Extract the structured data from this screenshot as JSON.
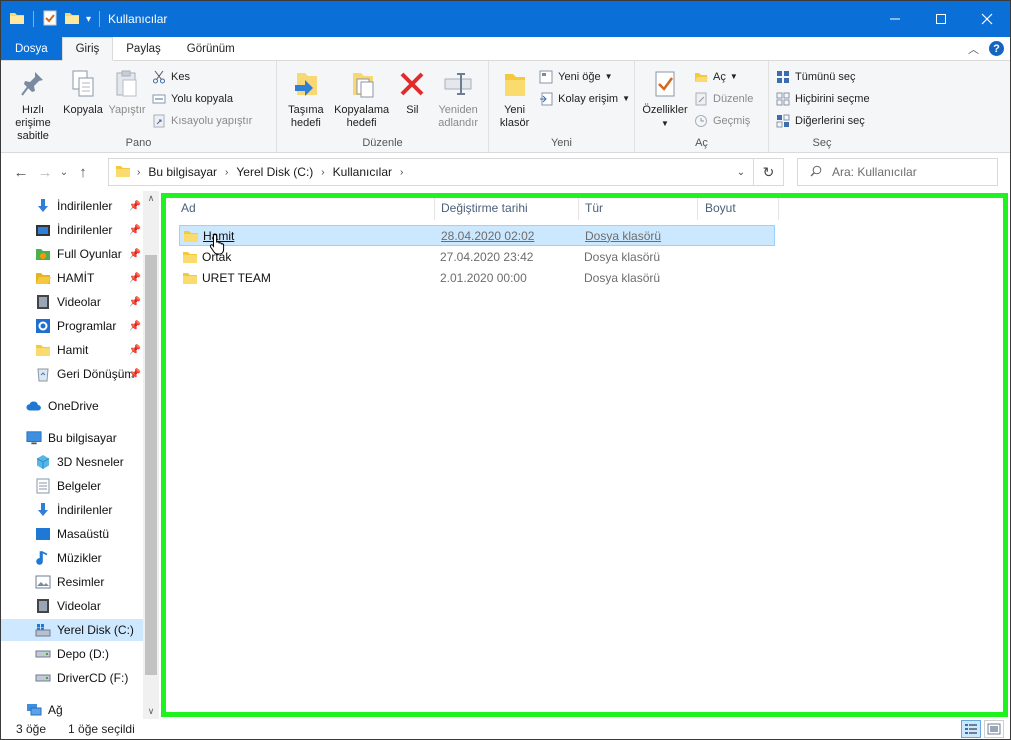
{
  "window": {
    "title": "Kullanıcılar",
    "accent": "#0a6fd6",
    "controls": [
      "minimize",
      "maximize",
      "close"
    ]
  },
  "ribbon_tabs": [
    {
      "label": "Dosya"
    },
    {
      "label": "Giriş"
    },
    {
      "label": "Paylaş"
    },
    {
      "label": "Görünüm"
    }
  ],
  "ribbon": {
    "pano": {
      "label": "Pano",
      "pin": "Hızlı erişime sabitle",
      "copy": "Kopyala",
      "paste": "Yapıştır",
      "cut": "Kes",
      "copy_path": "Yolu kopyala",
      "paste_shortcut": "Kısayolu yapıştır"
    },
    "duzenle": {
      "label": "Düzenle",
      "move_to": "Taşıma hedefi",
      "copy_to": "Kopyalama hedefi",
      "delete": "Sil",
      "rename": "Yeniden adlandır"
    },
    "yeni": {
      "label": "Yeni",
      "new_folder": "Yeni klasör",
      "new_item": "Yeni öğe",
      "easy_access": "Kolay erişim"
    },
    "ac": {
      "label": "Aç",
      "properties": "Özellikler",
      "open": "Aç",
      "edit": "Düzenle",
      "history": "Geçmiş"
    },
    "sec": {
      "label": "Seç",
      "select_all": "Tümünü seç",
      "select_none": "Hiçbirini seçme",
      "invert": "Diğerlerini seç"
    }
  },
  "address": {
    "crumbs": [
      "Bu bilgisayar",
      "Yerel Disk (C:)",
      "Kullanıcılar"
    ]
  },
  "search": {
    "placeholder": "Ara: Kullanıcılar"
  },
  "nav_pane": {
    "quick_access": [
      {
        "label": "İndirilenler",
        "icon": "download-arrow-icon",
        "pinned": true
      },
      {
        "label": "İndirilenler",
        "icon": "video-folder-icon",
        "pinned": true
      },
      {
        "label": "Full Oyunlar",
        "icon": "folder-green-icon",
        "pinned": true
      },
      {
        "label": "HAMİT",
        "icon": "folder-open-icon",
        "pinned": true
      },
      {
        "label": "Videolar",
        "icon": "film-icon",
        "pinned": true
      },
      {
        "label": "Programlar",
        "icon": "gear-icon",
        "pinned": true
      },
      {
        "label": "Hamit",
        "icon": "folder-icon",
        "pinned": true
      },
      {
        "label": "Geri Dönüşüm",
        "icon": "recycle-bin-icon",
        "pinned": true
      }
    ],
    "onedrive": "OneDrive",
    "this_pc": "Bu bilgisayar",
    "pc_items": [
      {
        "label": "3D Nesneler",
        "icon": "cube-icon"
      },
      {
        "label": "Belgeler",
        "icon": "document-icon"
      },
      {
        "label": "İndirilenler",
        "icon": "download-arrow-icon"
      },
      {
        "label": "Masaüstü",
        "icon": "desktop-icon"
      },
      {
        "label": "Müzikler",
        "icon": "music-note-icon"
      },
      {
        "label": "Resimler",
        "icon": "picture-icon"
      },
      {
        "label": "Videolar",
        "icon": "film-icon"
      },
      {
        "label": "Yerel Disk (C:)",
        "icon": "windows-drive-icon",
        "selected": true
      },
      {
        "label": "Depo (D:)",
        "icon": "drive-icon"
      },
      {
        "label": "DriverCD (F:)",
        "icon": "drive-icon"
      }
    ],
    "network": "Ağ"
  },
  "columns": {
    "name": "Ad",
    "date": "Değiştirme tarihi",
    "type": "Tür",
    "size": "Boyut"
  },
  "files": [
    {
      "name": "Hamit",
      "date": "28.04.2020 02:02",
      "type": "Dosya klasörü",
      "selected": true
    },
    {
      "name": "Ortak",
      "date": "27.04.2020 23:42",
      "type": "Dosya klasörü"
    },
    {
      "name": "URET TEAM",
      "date": "2.01.2020 00:00",
      "type": "Dosya klasörü"
    }
  ],
  "status": {
    "count": "3 öğe",
    "selected": "1 öğe seçildi"
  },
  "highlight_color": "#1ff21f"
}
